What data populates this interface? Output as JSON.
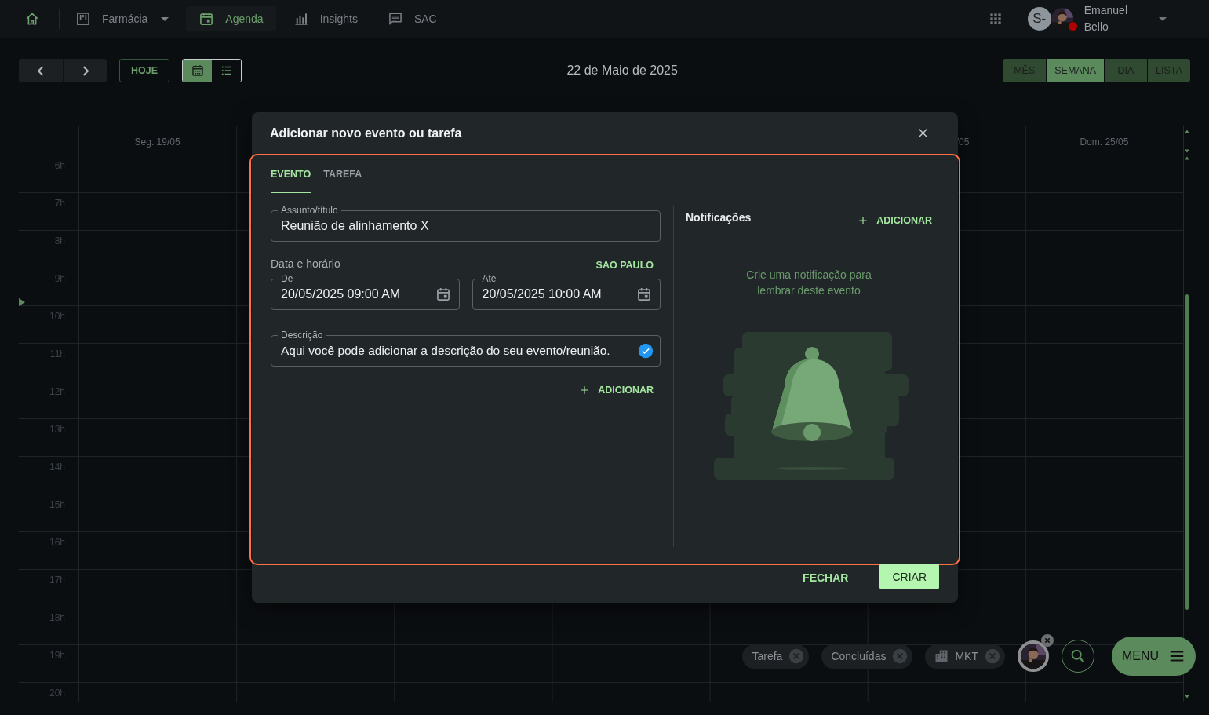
{
  "nav": {
    "items": [
      {
        "label": "Farmácia",
        "dropdown": true,
        "selected": false
      },
      {
        "label": "Agenda",
        "dropdown": false,
        "selected": true
      },
      {
        "label": "Insights",
        "dropdown": false,
        "selected": false
      },
      {
        "label": "SAC",
        "dropdown": false,
        "selected": false
      }
    ]
  },
  "user": {
    "initials": "S-",
    "name_lines": [
      "Emanuel",
      "Bello"
    ]
  },
  "toolbar": {
    "today": "HOJE",
    "view_toggle": [
      {
        "kind": "calendar",
        "selected": true
      },
      {
        "kind": "list",
        "selected": false
      }
    ],
    "date": "22 de Maio de 2025",
    "views": [
      {
        "label": "MÊS",
        "selected": false
      },
      {
        "label": "SEMANA",
        "selected": true
      },
      {
        "label": "DIA",
        "selected": false
      },
      {
        "label": "LISTA",
        "selected": false
      }
    ]
  },
  "calendar": {
    "day_headers": [
      "Seg. 19/05",
      "/05",
      "Dom. 25/05"
    ],
    "hours": [
      "6h",
      "7h",
      "8h",
      "9h",
      "10h",
      "11h",
      "12h",
      "13h",
      "14h",
      "15h",
      "16h",
      "17h",
      "18h",
      "19h",
      "20h"
    ]
  },
  "dialog": {
    "title": "Adicionar novo evento ou tarefa",
    "tabs": [
      {
        "label": "EVENTO",
        "selected": true
      },
      {
        "label": "TAREFA",
        "selected": false
      }
    ],
    "subject": {
      "label": "Assunto/título",
      "value": "Reunião de alinhamento X"
    },
    "date_section": {
      "label": "Data e horário",
      "timezone": "SAO PAULO",
      "from": {
        "label": "De",
        "value": "20/05/2025 09:00 AM"
      },
      "to": {
        "label": "Até",
        "value": "20/05/2025 10:00 AM"
      }
    },
    "description": {
      "label": "Descrição",
      "value": "Aqui você pode adicionar a descrição do seu evento/reunião.",
      "verified": true
    },
    "add_button": "ADICIONAR",
    "notifications": {
      "title": "Notificações",
      "add_button": "ADICIONAR",
      "empty_message": "Crie uma notificação para lembrar deste evento"
    },
    "buttons": [
      {
        "label": "FECHAR",
        "kind": "text"
      },
      {
        "label": "CRIAR",
        "kind": "primary"
      }
    ]
  },
  "filters": [
    {
      "kind": "text",
      "label": "Tarefa"
    },
    {
      "kind": "text",
      "label": "Concluídas"
    },
    {
      "kind": "icon",
      "label": "MKT"
    },
    {
      "kind": "avatar"
    }
  ],
  "menu_button": "MENU"
}
